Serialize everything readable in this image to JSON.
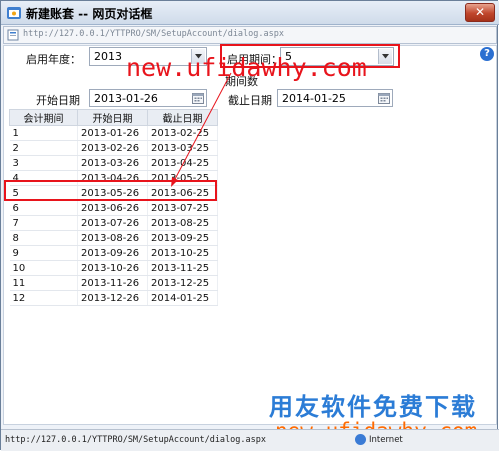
{
  "window": {
    "title": "新建账套 -- 网页对话框",
    "close_label": "✕"
  },
  "address": {
    "url": "http://127.0.0.1/YTTPRO/SM/SetupAccount/dialog.aspx"
  },
  "form": {
    "start_year_label": "启用年度：",
    "start_year_value": "2013",
    "start_period_label": "启用期间：",
    "start_period_value": "5",
    "period_count_label": "期间数",
    "start_date_label": "开始日期",
    "start_date_value": "2013-01-26",
    "end_date_label": "截止日期",
    "end_date_value": "2014-01-25"
  },
  "table": {
    "columns": [
      "会计期间",
      "开始日期",
      "截止日期"
    ],
    "rows": [
      [
        "1",
        "2013-01-26",
        "2013-02-25"
      ],
      [
        "2",
        "2013-02-26",
        "2013-03-25"
      ],
      [
        "3",
        "2013-03-26",
        "2013-04-25"
      ],
      [
        "4",
        "2013-04-26",
        "2013-05-25"
      ],
      [
        "5",
        "2013-05-26",
        "2013-06-25"
      ],
      [
        "6",
        "2013-06-26",
        "2013-07-25"
      ],
      [
        "7",
        "2013-07-26",
        "2013-08-25"
      ],
      [
        "8",
        "2013-08-26",
        "2013-09-25"
      ],
      [
        "9",
        "2013-09-26",
        "2013-10-25"
      ],
      [
        "10",
        "2013-10-26",
        "2013-11-25"
      ],
      [
        "11",
        "2013-11-26",
        "2013-12-25"
      ],
      [
        "12",
        "2013-12-26",
        "2014-01-25"
      ]
    ]
  },
  "watermarks": {
    "top_url": "new.ufidawhy.com",
    "bottom_cn": "用友软件免费下载",
    "bottom_url": "new.ufidawhy.com"
  },
  "status": {
    "url": "http://127.0.0.1/YTTPRO/SM/SetupAccount/dialog.aspx",
    "zone": "Internet"
  },
  "colors": {
    "highlight": "#e8141c",
    "accent": "#2b7cd6",
    "orange": "#ff6a00"
  },
  "icons": [
    "app-icon",
    "page-icon",
    "help-icon",
    "dropdown-arrow-icon",
    "calendar-icon",
    "globe-icon"
  ]
}
